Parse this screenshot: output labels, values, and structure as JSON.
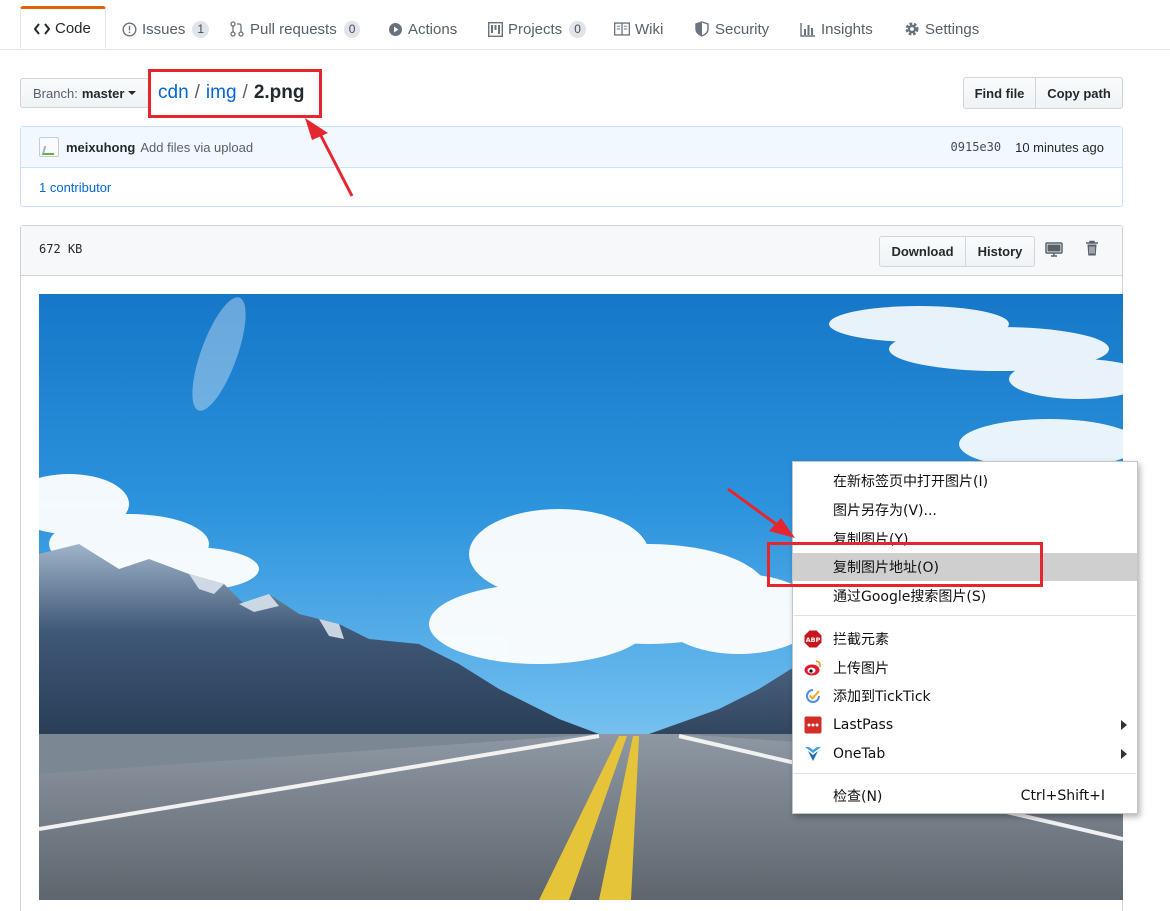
{
  "tabs": [
    {
      "label": "Code",
      "icon": "code-icon"
    },
    {
      "label": "Issues",
      "count": "1",
      "icon": "issue-icon"
    },
    {
      "label": "Pull requests",
      "count": "0",
      "icon": "pull-request-icon"
    },
    {
      "label": "Actions",
      "icon": "play-icon"
    },
    {
      "label": "Projects",
      "count": "0",
      "icon": "project-icon"
    },
    {
      "label": "Wiki",
      "icon": "book-icon"
    },
    {
      "label": "Security",
      "icon": "shield-icon"
    },
    {
      "label": "Insights",
      "icon": "graph-icon"
    },
    {
      "label": "Settings",
      "icon": "gear-icon"
    }
  ],
  "branch": {
    "prefix": "Branch:",
    "name": "master"
  },
  "breadcrumb": {
    "repo": "cdn",
    "sep1": "/",
    "folder": "img",
    "sep2": "/",
    "file": "2.png"
  },
  "header_buttons": {
    "find_file": "Find file",
    "copy_path": "Copy path"
  },
  "commit": {
    "author": "meixuhong",
    "message": "Add files via upload",
    "sha": "0915e30",
    "time": "10 minutes ago",
    "contributors": "1 contributor"
  },
  "file": {
    "size": "672 KB",
    "download": "Download",
    "history": "History"
  },
  "context_menu": {
    "items": [
      {
        "label": "在新标签页中打开图片(I)"
      },
      {
        "label": "图片另存为(V)..."
      },
      {
        "label": "复制图片(Y)"
      },
      {
        "label": "复制图片地址(O)"
      },
      {
        "label": "通过Google搜索图片(S)"
      },
      {
        "label": "拦截元素",
        "icon": "abp-icon"
      },
      {
        "label": "上传图片",
        "icon": "weibo-icon"
      },
      {
        "label": "添加到TickTick",
        "icon": "ticktick-icon"
      },
      {
        "label": "LastPass",
        "icon": "lastpass-icon"
      },
      {
        "label": "OneTab",
        "icon": "onetab-icon"
      },
      {
        "label": "检查(N)",
        "shortcut": "Ctrl+Shift+I"
      }
    ]
  },
  "colors": {
    "accent_tab": "#e36209",
    "link": "#0366d6",
    "annotation": "#e5262f",
    "menu_highlight": "#cfcfcf"
  }
}
